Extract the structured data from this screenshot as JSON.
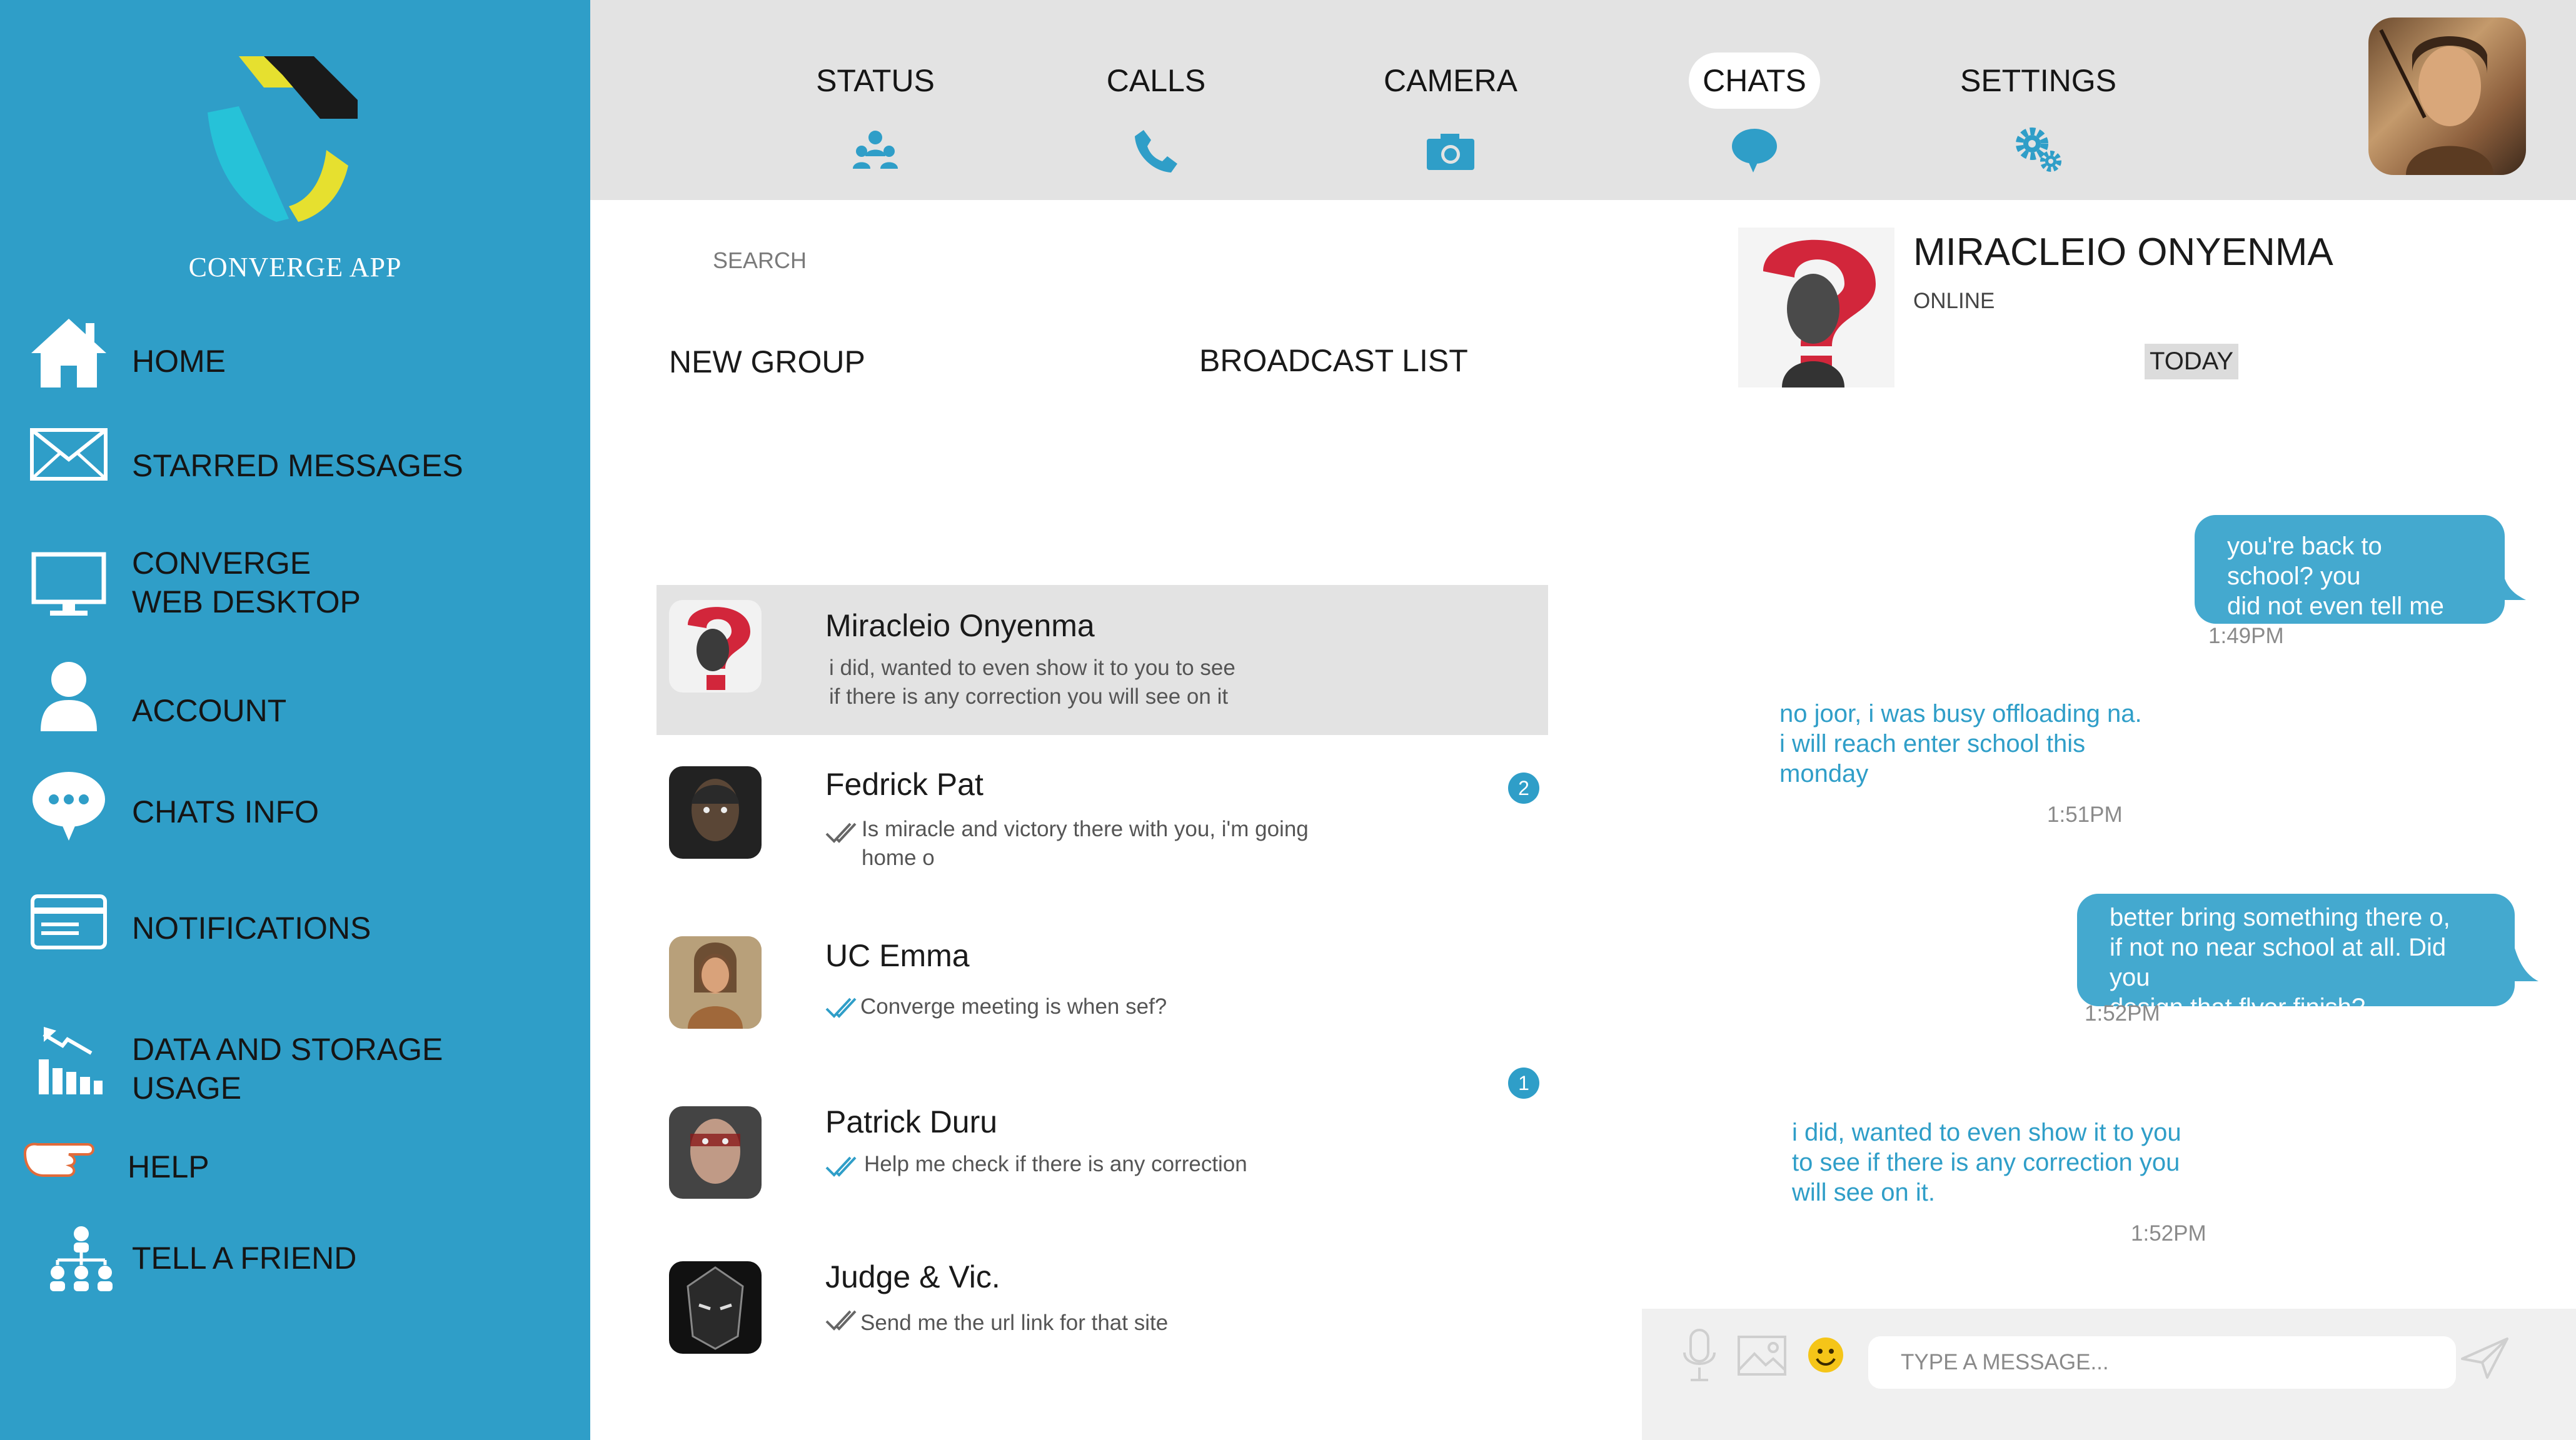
{
  "app": {
    "name": "CONVERGE APP"
  },
  "colors": {
    "accent": "#2f9ec8",
    "sidebar": "#2f9ec8",
    "topbar": "#e3e3e3",
    "logo_yellow": "#e6e02f",
    "logo_cyan": "#26c2d8",
    "logo_dark": "#1a1a1a"
  },
  "sidebar": {
    "items": [
      {
        "label": "HOME",
        "icon": "house-icon"
      },
      {
        "label": "STARRED MESSAGES",
        "icon": "envelope-icon"
      },
      {
        "label": "CONVERGE\nWEB DESKTOP",
        "icon": "monitor-icon"
      },
      {
        "label": "ACCOUNT",
        "icon": "person-icon"
      },
      {
        "label": "CHATS INFO",
        "icon": "speech-bubble-icon"
      },
      {
        "label": "NOTIFICATIONS",
        "icon": "card-icon"
      },
      {
        "label": "DATA AND STORAGE\nUSAGE",
        "icon": "bar-chart-icon"
      },
      {
        "label": "HELP",
        "icon": "pointing-hand-icon"
      },
      {
        "label": "TELL A FRIEND",
        "icon": "network-icon"
      }
    ]
  },
  "tabs": [
    {
      "label": "STATUS",
      "icon": "people-icon"
    },
    {
      "label": "CALLS",
      "icon": "phone-icon"
    },
    {
      "label": "CAMERA",
      "icon": "camera-icon"
    },
    {
      "label": "CHATS",
      "icon": "chat-bubble-icon",
      "active": true
    },
    {
      "label": "SETTINGS",
      "icon": "gears-icon"
    }
  ],
  "search": {
    "placeholder": "SEARCH"
  },
  "actions": {
    "new_group": "NEW GROUP",
    "broadcast_list": "BROADCAST LIST"
  },
  "chats": [
    {
      "name": "Miracleio Onyenma",
      "message": "i did, wanted to even show it to you to see\nif there is any correction you will see on it",
      "selected": true
    },
    {
      "name": "Fedrick Pat",
      "message": "Is miracle and victory there with you, i'm going\nhome o",
      "unread": "2"
    },
    {
      "name": "UC Emma",
      "message": "Converge meeting is when sef?"
    },
    {
      "name": "Patrick Duru",
      "message": "Help me check if there is any correction",
      "unread": "1"
    },
    {
      "name": "Judge & Vic.",
      "message": "Send me the url link for that site"
    }
  ],
  "conversation": {
    "contact_name": "MIRACLEIO ONYENMA",
    "contact_status": "ONLINE",
    "day_label": "TODAY",
    "messages": [
      {
        "direction": "out",
        "text": "you're back to school? you\ndid not even tell me",
        "time": "1:49PM"
      },
      {
        "direction": "in",
        "text": "no joor, i was busy offloading na.\ni will reach enter school this\nmonday",
        "time": "1:51PM"
      },
      {
        "direction": "out",
        "text": "better bring something there o,\n if not no near school at all. Did you\ndesign that flyer finish?",
        "time": "1:52PM"
      },
      {
        "direction": "in",
        "text": "i did, wanted to even show  it to you\nto see if there is any correction you\nwill see on it.",
        "time": "1:52PM"
      }
    ],
    "input": {
      "placeholder": "TYPE A MESSAGE..."
    },
    "input_icons": [
      "microphone-icon",
      "image-icon",
      "emoji-icon",
      "send-icon"
    ]
  }
}
